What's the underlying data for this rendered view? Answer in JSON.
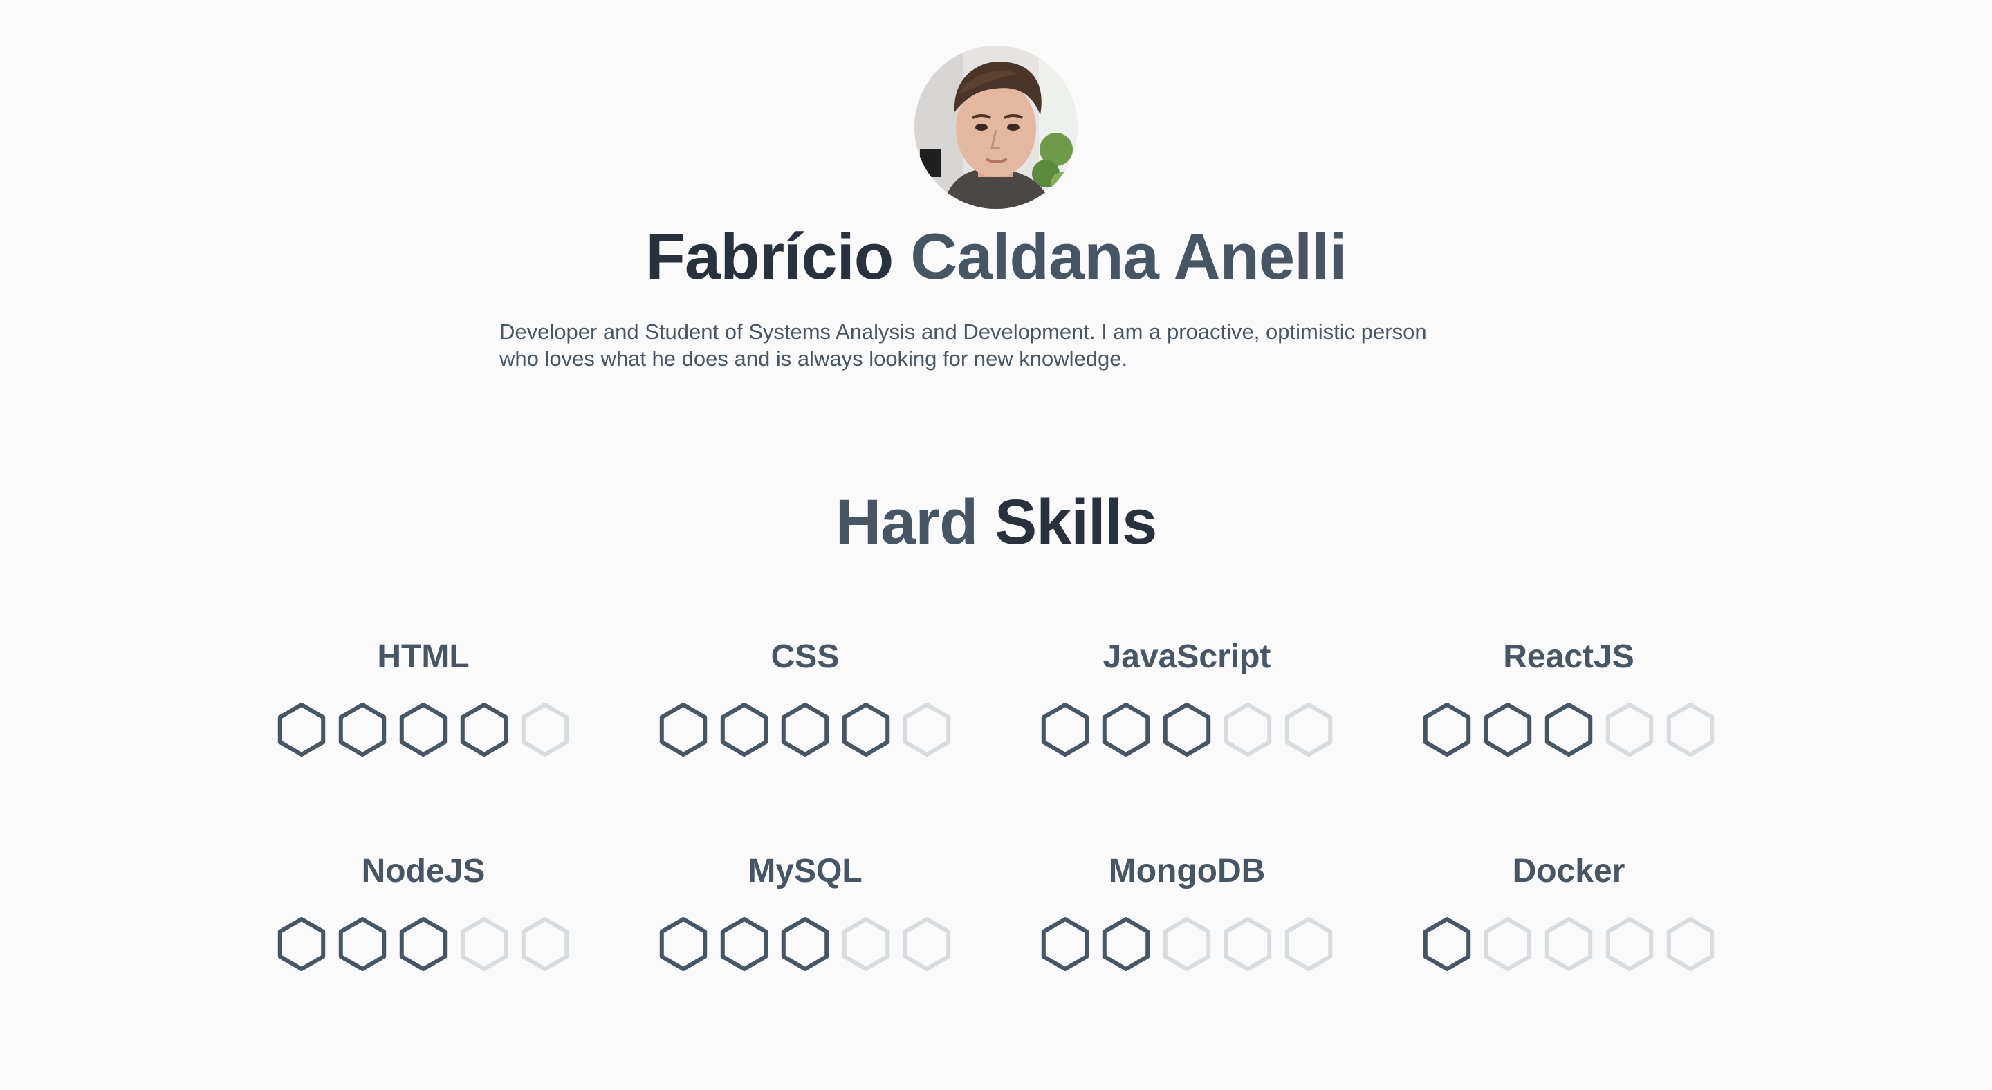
{
  "profile": {
    "first_name": "Fabrício",
    "last_name": "Caldana Anelli",
    "bio": "Developer and Student of Systems Analysis and Development. I am a proactive, optimistic person who loves what he does and is always looking for new knowledge."
  },
  "section": {
    "title_word1": "Hard",
    "title_word2": "Skills"
  },
  "colors": {
    "background": "#fafafa",
    "heading_dark": "#29323c",
    "heading_slate": "#485563",
    "hex_filled": "#485563",
    "hex_empty": "#d9dbdd"
  },
  "rating_max": 5,
  "skills": [
    {
      "name": "HTML",
      "level": 4
    },
    {
      "name": "CSS",
      "level": 4
    },
    {
      "name": "JavaScript",
      "level": 3
    },
    {
      "name": "ReactJS",
      "level": 3
    },
    {
      "name": "NodeJS",
      "level": 3
    },
    {
      "name": "MySQL",
      "level": 3
    },
    {
      "name": "MongoDB",
      "level": 2
    },
    {
      "name": "Docker",
      "level": 1
    }
  ]
}
